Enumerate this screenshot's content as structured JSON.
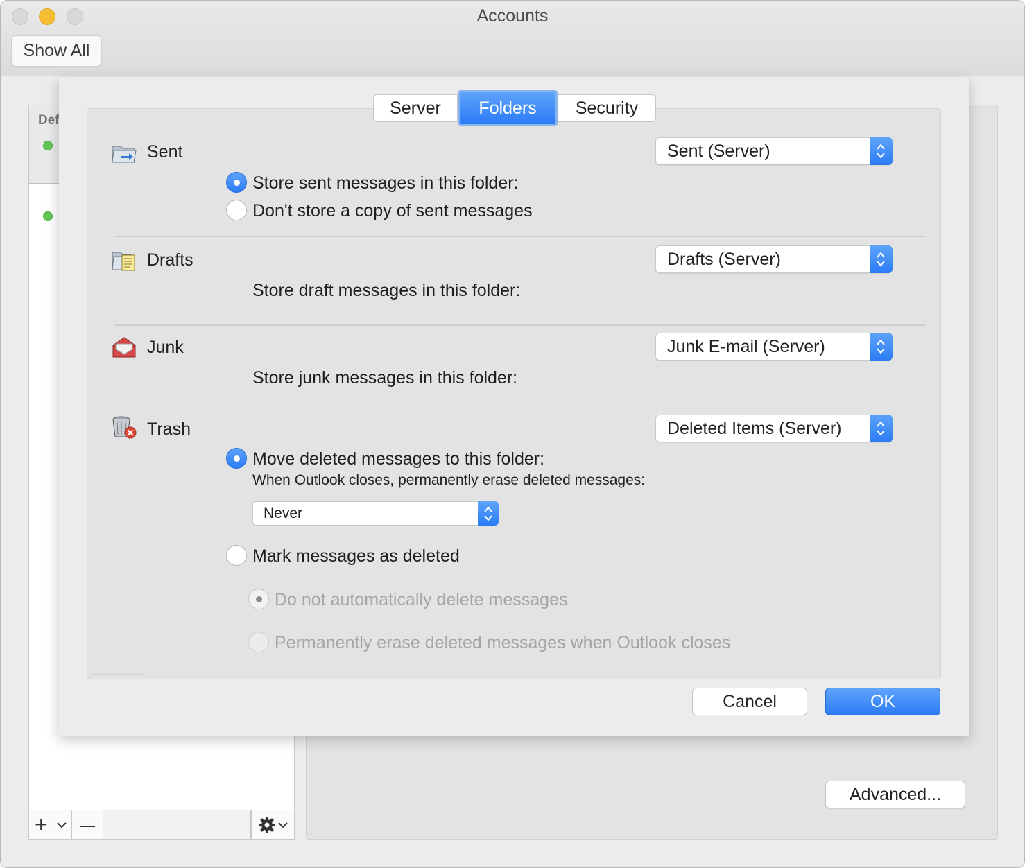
{
  "window": {
    "title": "Accounts",
    "show_all_label": "Show All"
  },
  "account_list": {
    "header_label": "Def",
    "toolbar": {
      "add_label": "+",
      "add_menu_icon": "chevron-down-icon",
      "remove_label": "—",
      "action_icon": "gear-icon"
    }
  },
  "detail": {
    "advanced_label": "Advanced..."
  },
  "sheet": {
    "tabs": [
      {
        "label": "Server",
        "selected": false
      },
      {
        "label": "Folders",
        "selected": true
      },
      {
        "label": "Security",
        "selected": false
      }
    ],
    "sent": {
      "label": "Sent",
      "folder": "Sent (Server)",
      "options": [
        {
          "label": "Store sent messages in this folder:",
          "selected": true
        },
        {
          "label": "Don't store a copy of sent messages",
          "selected": false
        }
      ]
    },
    "drafts": {
      "label": "Drafts",
      "folder": "Drafts (Server)",
      "description": "Store draft messages in this folder:"
    },
    "junk": {
      "label": "Junk",
      "folder": "Junk E-mail (Server)",
      "description": "Store junk messages in this folder:"
    },
    "trash": {
      "label": "Trash",
      "folder": "Deleted Items (Server)",
      "move_option": "Move deleted messages to this folder:",
      "erase_note": "When Outlook closes, permanently erase deleted messages:",
      "erase_value": "Never",
      "mark_option": "Mark messages as deleted",
      "sub_options": [
        {
          "label": "Do not automatically delete messages",
          "selected": true,
          "disabled": true
        },
        {
          "label": "Permanently erase deleted messages when Outlook closes",
          "selected": false,
          "disabled": true
        }
      ]
    },
    "buttons": {
      "cancel": "Cancel",
      "ok": "OK"
    }
  },
  "colors": {
    "accent": "#2c7cf6",
    "status_green": "#62c655",
    "traffic_yellow": "#f6be33"
  }
}
